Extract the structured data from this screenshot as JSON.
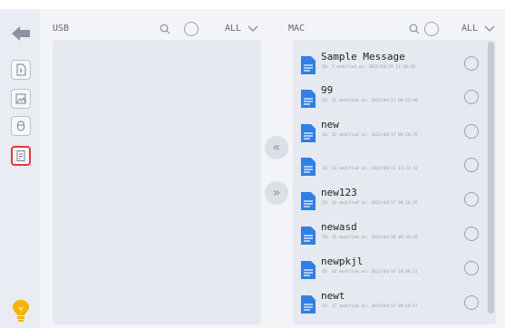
{
  "usb_panel": {
    "label": "USB",
    "filter": "ALL"
  },
  "mac_panel": {
    "label": "MAC",
    "filter": "ALL"
  },
  "transfer": {
    "to_left": "«",
    "to_right": "»"
  },
  "files": [
    {
      "name": "Sample Message",
      "meta": "ID: 1   modified on: 2023/04/29 11:30:39"
    },
    {
      "name": "99",
      "meta": "ID: 11   modified on: 2023/04/17 09:15:40"
    },
    {
      "name": "new",
      "meta": "ID: 12   modified on: 2023/04/17 09:20:35"
    },
    {
      "name": "",
      "meta": "ID: 13   modified on: 2023/04/13 11:31:42"
    },
    {
      "name": "new123",
      "meta": "ID: 14   modified on: 2023/04/17 09:20:35"
    },
    {
      "name": "newasd",
      "meta": "ID: 15   modified on: 2023/04/18 09:34:42"
    },
    {
      "name": "newpkjl",
      "meta": "ID: 16   modified on: 2023/04/14 10:00:21"
    },
    {
      "name": "newt",
      "meta": "ID: 17   modified on: 2023/04/17 09:19:57"
    }
  ],
  "icons": {
    "back": "back-arrow-icon",
    "sidebar": [
      "file-transfer-icon",
      "image-icon",
      "mouse-icon",
      "message-file-icon"
    ],
    "hint": "lightbulb-icon"
  },
  "colors": {
    "accent": "#2f7fe6",
    "selected_border": "#e23a3a",
    "bulb": "#f5b400"
  }
}
